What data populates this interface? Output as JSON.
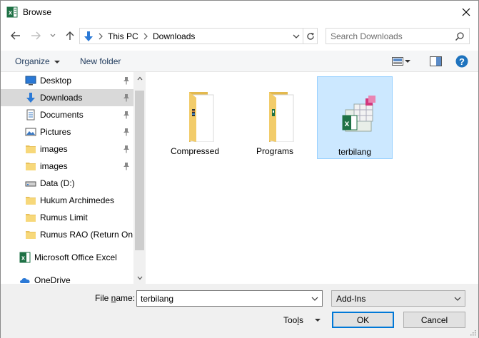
{
  "window": {
    "title": "Browse",
    "title_icon": "excel-icon"
  },
  "address": {
    "crumbs": [
      "This PC",
      "Downloads"
    ],
    "search_placeholder": "Search Downloads"
  },
  "toolbar": {
    "organize_label": "Organize",
    "new_folder_label": "New folder"
  },
  "nav": {
    "items": [
      {
        "label": "Desktop",
        "icon": "desktop-icon",
        "pinned": true
      },
      {
        "label": "Downloads",
        "icon": "downloads-icon",
        "pinned": true,
        "selected": true
      },
      {
        "label": "Documents",
        "icon": "documents-icon",
        "pinned": true
      },
      {
        "label": "Pictures",
        "icon": "pictures-icon",
        "pinned": true
      },
      {
        "label": "images",
        "icon": "folder-icon",
        "pinned": true
      },
      {
        "label": "images",
        "icon": "folder-icon",
        "pinned": true
      },
      {
        "label": "Data  (D:)",
        "icon": "drive-icon",
        "pinned": false
      },
      {
        "label": "Hukum Archimedes",
        "icon": "folder-icon",
        "pinned": false
      },
      {
        "label": "Rumus Limit",
        "icon": "folder-icon",
        "pinned": false
      },
      {
        "label": "Rumus RAO (Return On A",
        "icon": "folder-icon",
        "pinned": false
      },
      {
        "label": "Microsoft Office Excel",
        "icon": "excel-icon",
        "pinned": false
      },
      {
        "label": "OneDrive",
        "icon": "onedrive-icon",
        "pinned": false
      }
    ]
  },
  "content": {
    "tiles": [
      {
        "label": "Compressed",
        "icon": "folder-icon"
      },
      {
        "label": "Programs",
        "icon": "folder-icon"
      },
      {
        "label": "terbilang",
        "icon": "excel-addin-icon",
        "selected": true
      }
    ]
  },
  "bottom": {
    "file_name_label_pre": "File ",
    "file_name_label_ul": "n",
    "file_name_label_post": "ame:",
    "file_name_value": "terbilang",
    "filter_value": "Add-Ins",
    "tools_label_pre": "Too",
    "tools_label_ul": "l",
    "tools_label_post": "s",
    "ok_label": "OK",
    "cancel_label": "Cancel"
  },
  "colors": {
    "selection_fill": "#cce8ff",
    "selection_border": "#99d1ff",
    "accent": "#0078d7",
    "help_icon": "#1e73be"
  }
}
